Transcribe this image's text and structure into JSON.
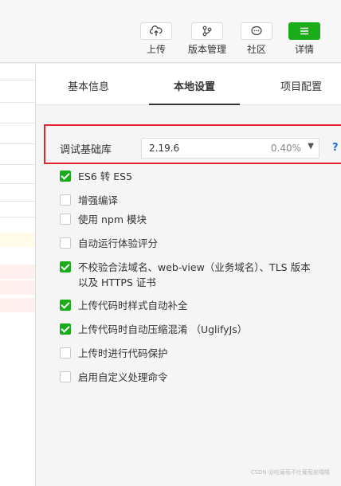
{
  "toolbar": {
    "upload": "上传",
    "version": "版本管理",
    "community": "社区",
    "details": "详情"
  },
  "tabs": [
    {
      "label": "基本信息"
    },
    {
      "label": "本地设置"
    },
    {
      "label": "项目配置"
    }
  ],
  "library": {
    "label": "调试基础库",
    "version": "2.19.6",
    "usage": "0.40%",
    "help": "?"
  },
  "options": [
    {
      "label": "ES6 转 ES5",
      "checked": true
    },
    {
      "label": "增强编译",
      "checked": false
    },
    {
      "label": "使用 npm 模块",
      "checked": false
    },
    {
      "label": "自动运行体验评分",
      "checked": false
    },
    {
      "label": "不校验合法域名、web-view（业务域名）、TLS 版本以及 HTTPS 证书",
      "checked": true
    },
    {
      "label": "上传代码时样式自动补全",
      "checked": true
    },
    {
      "label": "上传代码时自动压缩混淆 （UglifyJs）",
      "checked": true
    },
    {
      "label": "上传时进行代码保护",
      "checked": false
    },
    {
      "label": "启用自定义处理命令",
      "checked": false
    }
  ],
  "colors": {
    "accent_green": "#1aad19",
    "highlight_red": "#e0282e",
    "help_blue": "#1a6fd6"
  },
  "watermark": "CSDN @吃葡萄不吐葡萄皮嘻嘻"
}
